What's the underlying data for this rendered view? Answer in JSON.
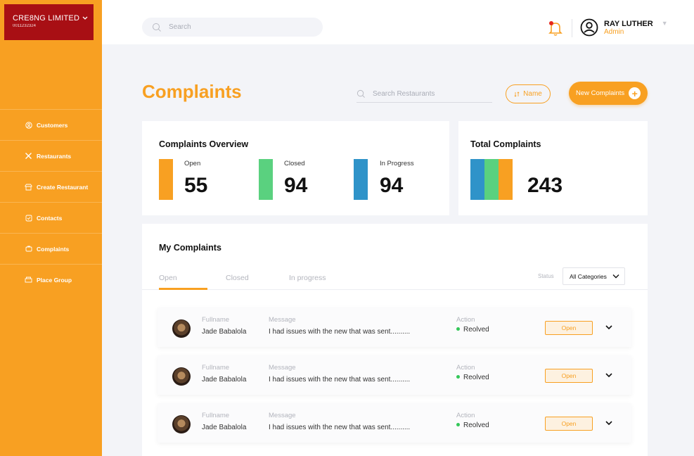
{
  "org": {
    "name": "CRE8NG LIMITED",
    "code": "0011232324"
  },
  "nav": [
    {
      "label": "Customers",
      "icon": "user-circle-icon"
    },
    {
      "label": "Restaurants",
      "icon": "utensils-icon"
    },
    {
      "label": "Create Restaurant",
      "icon": "store-add-icon"
    },
    {
      "label": "Contacts",
      "icon": "contacts-icon"
    },
    {
      "label": "Complaints",
      "icon": "complaints-icon"
    },
    {
      "label": "Place Group",
      "icon": "group-icon"
    }
  ],
  "header": {
    "search_placeholder": "Search",
    "user_name": "RAY LUTHER",
    "user_role": "Admin"
  },
  "page": {
    "title": "Complaints",
    "restaurant_search_placeholder": "Search Restaurants",
    "filter_label": "Name",
    "new_button_label": "New Complaints"
  },
  "overview": {
    "title": "Complaints Overview",
    "stats": [
      {
        "label": "Open",
        "value": "55",
        "color": "#f8a022"
      },
      {
        "label": "Closed",
        "value": "94",
        "color": "#5ad17f"
      },
      {
        "label": "In Progress",
        "value": "94",
        "color": "#2f93c9"
      }
    ]
  },
  "total": {
    "title": "Total Complaints",
    "value": "243"
  },
  "my_complaints": {
    "title": "My Complaints",
    "tabs": [
      "Open",
      "Closed",
      "In progress"
    ],
    "status_label": "Status",
    "status_value": "All Categories",
    "headers": {
      "fullname": "Fullname",
      "message": "Message",
      "action": "Action"
    },
    "rows": [
      {
        "fullname": "Jade Babalola",
        "message": "I had issues with the new that was sent..........",
        "action": "Reolved",
        "status": "Open"
      },
      {
        "fullname": "Jade Babalola",
        "message": "I had issues with the new that was sent..........",
        "action": "Reolved",
        "status": "Open"
      },
      {
        "fullname": "Jade Babalola",
        "message": "I had issues with the new that was sent..........",
        "action": "Reolved",
        "status": "Open"
      }
    ]
  },
  "colors": {
    "brand": "#f8a022",
    "org_bg": "#a80f14",
    "resolved": "#34c759"
  }
}
